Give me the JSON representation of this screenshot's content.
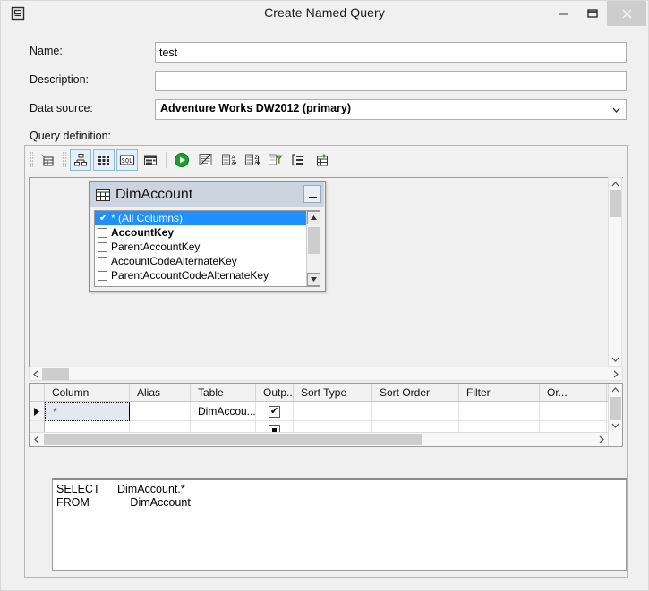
{
  "window": {
    "title": "Create Named Query",
    "sysicon": "window-menu-icon",
    "buttons": {
      "minimize": "minimize-icon",
      "maximize": "maximize-icon",
      "close": "close-icon"
    }
  },
  "form": {
    "name_label": "Name:",
    "name_value": "test",
    "name_placeholder": "",
    "description_label": "Description:",
    "description_value": "",
    "description_placeholder": "",
    "datasource_label": "Data source:",
    "datasource_value": "Adventure Works DW2012 (primary)",
    "datasource_options": [
      "Adventure Works DW2012 (primary)"
    ],
    "query_definition_label": "Query definition:"
  },
  "toolbar": {
    "buttons": [
      {
        "name": "add-table-icon",
        "glyph": "add-table",
        "active": false
      },
      {
        "name": "show-diagram-pane-icon",
        "glyph": "diagram",
        "active": true
      },
      {
        "name": "show-grid-pane-icon",
        "glyph": "grid",
        "active": true
      },
      {
        "name": "show-sql-pane-icon",
        "glyph": "sql",
        "active": true
      },
      {
        "name": "show-results-pane-icon",
        "glyph": "results",
        "active": false
      },
      {
        "name": "run-query-icon",
        "glyph": "run",
        "active": false
      },
      {
        "name": "verify-sql-icon",
        "glyph": "verify",
        "active": false
      },
      {
        "name": "sort-ascending-icon",
        "glyph": "sort-asc",
        "active": false
      },
      {
        "name": "sort-descending-icon",
        "glyph": "sort-desc",
        "active": false
      },
      {
        "name": "remove-filter-icon",
        "glyph": "remove-filter",
        "active": false
      },
      {
        "name": "use-group-by-icon",
        "glyph": "group-by",
        "active": false
      },
      {
        "name": "add-derived-table-icon",
        "glyph": "derived-table",
        "active": false
      }
    ]
  },
  "diagram": {
    "table": {
      "title": "DimAccount",
      "icon": "table-icon",
      "minimize_label": "minimize",
      "columns": [
        {
          "label": "* (All Columns)",
          "checked": true,
          "selected": true,
          "bold": false
        },
        {
          "label": "AccountKey",
          "checked": false,
          "selected": false,
          "bold": true
        },
        {
          "label": "ParentAccountKey",
          "checked": false,
          "selected": false,
          "bold": false
        },
        {
          "label": "AccountCodeAlternateKey",
          "checked": false,
          "selected": false,
          "bold": false
        },
        {
          "label": "ParentAccountCodeAlternateKey",
          "checked": false,
          "selected": false,
          "bold": false
        }
      ]
    }
  },
  "grid": {
    "headers": [
      "Column",
      "Alias",
      "Table",
      "Outp...",
      "Sort Type",
      "Sort Order",
      "Filter",
      "Or..."
    ],
    "rows": [
      {
        "indicator": "current-row",
        "column": "*",
        "alias": "",
        "table": "DimAccou...",
        "output": true,
        "sort_type": "",
        "sort_order": "",
        "filter": "",
        "or": ""
      },
      {
        "indicator": "",
        "column": "",
        "alias": "",
        "table": "",
        "output": false,
        "sort_type": "",
        "sort_order": "",
        "filter": "",
        "or": ""
      }
    ]
  },
  "sql": {
    "lines": [
      {
        "keyword": "SELECT",
        "text": "DimAccount.*"
      },
      {
        "keyword": "FROM",
        "text": "   DimAccount"
      }
    ]
  },
  "colors": {
    "selection_blue": "#1e90ff",
    "caption_blue": "#ccd4e0",
    "toolbar_active": "#e4eff8",
    "close_button": "#cdcdcd",
    "run_green": "#1c9c2e"
  }
}
